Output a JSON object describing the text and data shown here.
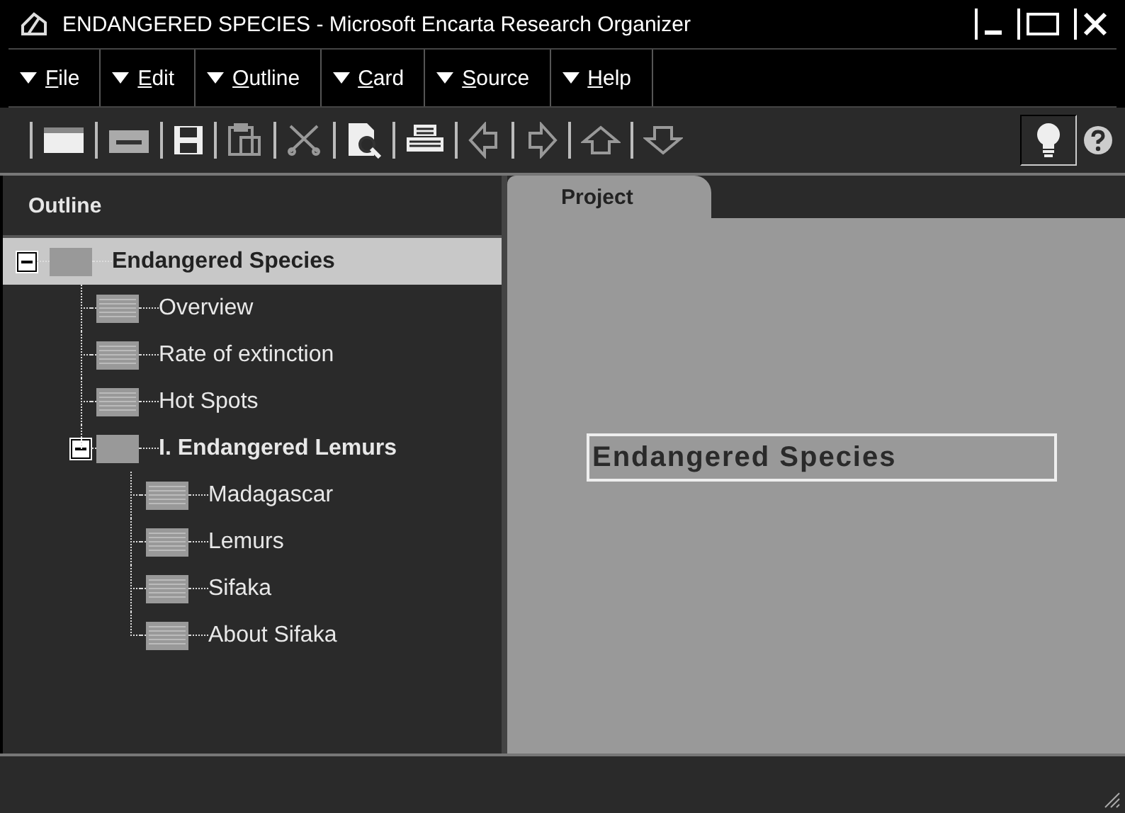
{
  "window": {
    "title": "ENDANGERED SPECIES - Microsoft Encarta Research Organizer"
  },
  "menu": [
    {
      "label": "File"
    },
    {
      "label": "Edit"
    },
    {
      "label": "Outline"
    },
    {
      "label": "Card"
    },
    {
      "label": "Source"
    },
    {
      "label": "Help"
    }
  ],
  "toolbar": [
    {
      "kind": "card",
      "disabled": false
    },
    {
      "kind": "folder",
      "disabled": false
    },
    {
      "kind": "save",
      "disabled": false
    },
    {
      "kind": "paste",
      "disabled": true
    },
    {
      "kind": "cut",
      "disabled": true
    },
    {
      "kind": "preview",
      "disabled": false
    },
    {
      "kind": "print",
      "disabled": false
    },
    {
      "kind": "left",
      "disabled": true
    },
    {
      "kind": "right",
      "disabled": true
    },
    {
      "kind": "up",
      "disabled": true
    },
    {
      "kind": "down",
      "disabled": true
    }
  ],
  "tips": {
    "pressed": true
  },
  "outline": {
    "title": "Outline",
    "items": [
      {
        "label": "Endangered Species",
        "kind": "folder",
        "selected": true,
        "expanded": true,
        "children": [
          {
            "label": "Overview",
            "kind": "page",
            "selected": false
          },
          {
            "label": "Rate of extinction",
            "kind": "page",
            "selected": false
          },
          {
            "label": "Hot Spots",
            "kind": "page",
            "selected": false
          },
          {
            "label": "I. Endangered Lemurs",
            "kind": "folder",
            "selected": false,
            "expanded": true,
            "children": [
              {
                "label": "Madagascar",
                "kind": "page",
                "selected": false
              },
              {
                "label": "Lemurs",
                "kind": "page",
                "selected": false
              },
              {
                "label": "Sifaka",
                "kind": "page",
                "selected": false
              },
              {
                "label": "About Sifaka",
                "kind": "page",
                "selected": false
              }
            ]
          }
        ]
      }
    ]
  },
  "tabs": [
    {
      "label": "Project",
      "selected": true
    }
  ],
  "project": {
    "title": "Endangered Species"
  }
}
